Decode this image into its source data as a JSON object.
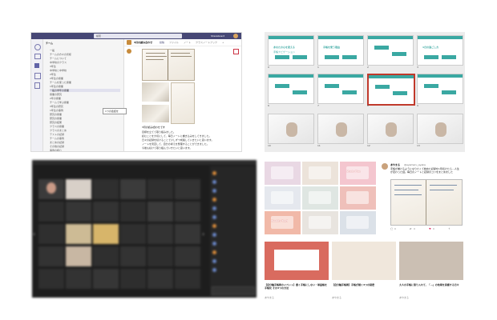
{
  "teams": {
    "search_placeholder": "検索",
    "org": "Shareboard",
    "sidebar_title": "チーム",
    "channel_title": "3月の読み合わせ",
    "channel_tabs": [
      "投稿",
      "ファイル",
      "ノート",
      "クラスノートブック",
      "+"
    ],
    "sidebar_items": [
      "一般",
      "チームの方々の皆様",
      "チームについて",
      "中学校のクラス",
      "3年生",
      "中学校と中学校",
      "2年生",
      "2年生の授業",
      "チームを使った授業",
      "1年生の授業",
      "一般の学年の授業",
      "授業の研究",
      "2年の授業",
      "チームで学ぶ授業",
      "3年生の研究",
      "1年生の事例",
      "研究の授業",
      "研究の授業",
      "研究の結果",
      "クラスの授業",
      "クラスのまとめ",
      "テストの記録",
      "チームの事例",
      "まとめの記録",
      "その他の記録",
      "事例の紹介"
    ],
    "tooltip": "1つの会話を",
    "post_caption": "3月の読み合わせです",
    "post_lines": [
      "目標を立てて取り組みました。",
      "読むことを大切にして、毎日ノートに書き込みをしてきました。",
      "日々の記録を続けることで少しずつ成長していきたいと思います。",
      "ノートを見直して、自分の考えを整理することができました。",
      "今後も続けて取り組んでいきたいと思います。"
    ]
  },
  "slides": {
    "cards": [
      {
        "num": "0",
        "title": "あなたの心を変える",
        "sub": "手帳ナビゲーション"
      },
      {
        "num": "1",
        "title": "手帳を使う理由",
        "sub": ""
      },
      {
        "num": "2",
        "title": "",
        "sub": ""
      },
      {
        "num": "3",
        "title": "1日の過ごし方",
        "sub": ""
      },
      {
        "num": "6",
        "title": "",
        "sub": ""
      },
      {
        "num": "7",
        "title": "",
        "sub": ""
      },
      {
        "num": "8",
        "title": "",
        "sub": ""
      },
      {
        "num": "9",
        "title": "",
        "sub": ""
      },
      {
        "num": "10",
        "title": "",
        "sub": ""
      },
      {
        "num": "11",
        "title": "",
        "sub": ""
      },
      {
        "num": "12",
        "title": "",
        "sub": ""
      },
      {
        "num": "13",
        "title": "",
        "sub": ""
      },
      {
        "num": "14",
        "title": "",
        "sub": ""
      },
      {
        "num": "15",
        "title": "",
        "sub": ""
      },
      {
        "num": "16",
        "title": "",
        "sub": ""
      }
    ]
  },
  "zoom": {
    "participants": [
      "",
      "",
      "",
      "",
      "",
      "",
      "",
      "",
      "",
      "",
      "",
      "",
      "",
      "",
      "",
      "",
      "",
      "",
      "",
      "",
      "",
      "",
      "",
      "",
      "",
      "",
      "",
      "",
      "",
      ""
    ],
    "chat_lines": [
      "",
      "",
      "",
      "",
      "",
      "",
      "",
      "",
      "",
      "",
      "",
      ""
    ]
  },
  "blog": {
    "tiles": [
      "",
      "",
      "Study Plan",
      "",
      "",
      "",
      "Weekly Top5",
      "",
      ""
    ],
    "tweet_name": "あやまる",
    "tweet_handle": "@ayamaru_ayaka",
    "tweet_text": "手帳が書けるようになりたくて始めた記録を1年続けたら…人生が変わった話。毎日のノートと記録のコツをまとめました",
    "tweet_stats": [
      "0",
      "0",
      "0"
    ],
    "cards": [
      {
        "title": "【自分軸手帳術のイベント】書く手帳にしない・単語帳を手帳化 その3つの方法",
        "author": "あやまる"
      },
      {
        "title": "【自分軸手帳術】手帳が続く3つの秘密",
        "author": "あやまる"
      },
      {
        "title": "大人の手帳に取り入れて、「…」の効果を実感する日々",
        "author": "あやまる"
      }
    ]
  }
}
